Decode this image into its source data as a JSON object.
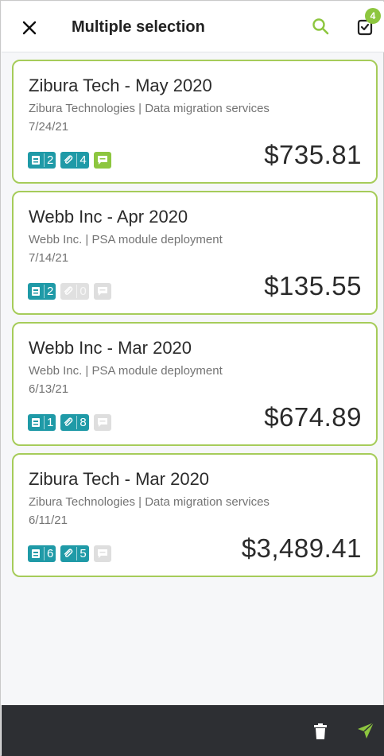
{
  "header": {
    "title": "Multiple selection",
    "close_icon": "close-icon",
    "search_icon": "search-icon",
    "cart_icon": "cart-check-icon",
    "cart_count": "4"
  },
  "colors": {
    "accent_green": "#8dc63f",
    "card_border": "#a6cc5a",
    "teal": "#1f9aa7",
    "bottom_bar": "#2d2f33"
  },
  "cards": [
    {
      "title": "Zibura Tech - May 2020",
      "subtitle": "Zibura Technologies | Data migration services",
      "date": "7/24/21",
      "receipts": "2",
      "attachments": "4",
      "attachments_active": true,
      "comments_active": true,
      "amount": "$735.81"
    },
    {
      "title": "Webb Inc - Apr 2020",
      "subtitle": "Webb Inc. | PSA module deployment",
      "date": "7/14/21",
      "receipts": "2",
      "attachments": "0",
      "attachments_active": false,
      "comments_active": false,
      "amount": "$135.55"
    },
    {
      "title": "Webb Inc - Mar 2020",
      "subtitle": "Webb Inc. | PSA module deployment",
      "date": "6/13/21",
      "receipts": "1",
      "attachments": "8",
      "attachments_active": true,
      "comments_active": false,
      "amount": "$674.89"
    },
    {
      "title": "Zibura Tech - Mar 2020",
      "subtitle": "Zibura Technologies | Data migration services",
      "date": "6/11/21",
      "receipts": "6",
      "attachments": "5",
      "attachments_active": true,
      "comments_active": false,
      "amount": "$3,489.41"
    }
  ],
  "bottom_bar": {
    "delete_icon": "trash-icon",
    "send_icon": "send-icon"
  }
}
